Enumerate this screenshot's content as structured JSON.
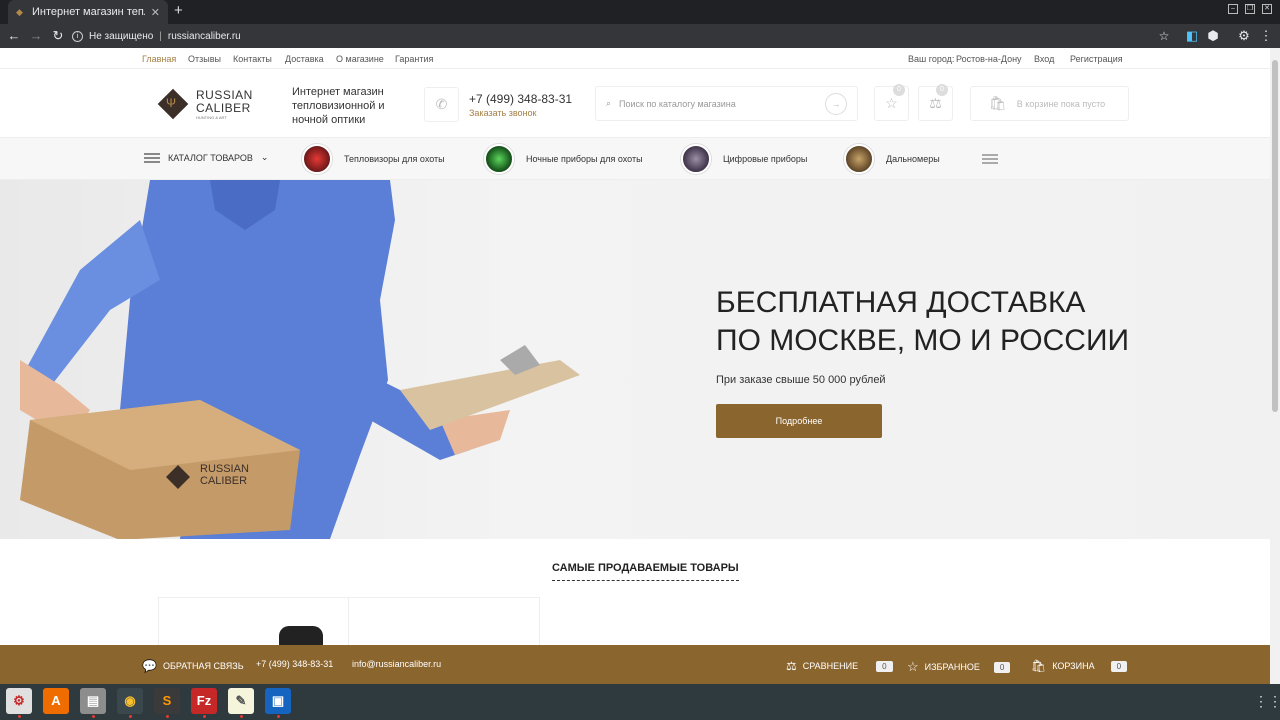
{
  "browser": {
    "tab_title": "Интернет магазин тепло",
    "security_label": "Не защищено",
    "url": "russiancaliber.ru"
  },
  "topbar": {
    "links": [
      "Главная",
      "Отзывы",
      "Контакты",
      "Доставка",
      "О магазине",
      "Гарантия"
    ],
    "city_label": "Ваш город:",
    "city": "Ростов-на-Дону",
    "login": "Вход",
    "register": "Регистрация"
  },
  "header": {
    "logo_line1": "RUSSIAN",
    "logo_line2": "CALIBER",
    "logo_line3": "HUNTING & ART",
    "tagline": "Интернет магазин тепловизионной и ночной оптики",
    "phone": "+7 (499) 348-83-31",
    "callback": "Заказать звонок",
    "search_placeholder": "Поиск по каталогу магазина",
    "favorites_count": "0",
    "compare_count": "0",
    "cart_text": "В корзине пока пусто"
  },
  "menu": {
    "catalog": "КАТАЛОГ ТОВАРОВ",
    "items": [
      "Тепловизоры для охоты",
      "Ночные приборы для охоты",
      "Цифровые приборы",
      "Дальномеры"
    ]
  },
  "hero": {
    "title_line1": "БЕСПЛАТНАЯ ДОСТАВКА",
    "title_line2": "ПО МОСКВЕ, МО И РОССИИ",
    "subtitle": "При заказе свыше 50 000 рублей",
    "button": "Подробнее",
    "box_logo_line1": "RUSSIAN",
    "box_logo_line2": "CALIBER"
  },
  "bestsellers": {
    "title": "САМЫЕ ПРОДАВАЕМЫЕ ТОВАРЫ"
  },
  "footer": {
    "feedback": "ОБРАТНАЯ СВЯЗЬ",
    "phone": "+7 (499) 348-83-31",
    "email": "info@russiancaliber.ru",
    "compare": "СРАВНЕНИЕ",
    "compare_count": "0",
    "favorites": "ИЗБРАННОЕ",
    "favorites_count": "0",
    "cart": "КОРЗИНА",
    "cart_count": "0"
  },
  "taskbar": {
    "apps": [
      "settings-app",
      "software-center",
      "file-manager",
      "chrome",
      "sublime-text",
      "filezilla",
      "text-editor",
      "image-viewer"
    ]
  },
  "colors": {
    "brand_brown": "#8b652e",
    "link_brown": "#a57e44",
    "dark_chrome": "#202124",
    "taskbar": "#2f3a3f"
  }
}
